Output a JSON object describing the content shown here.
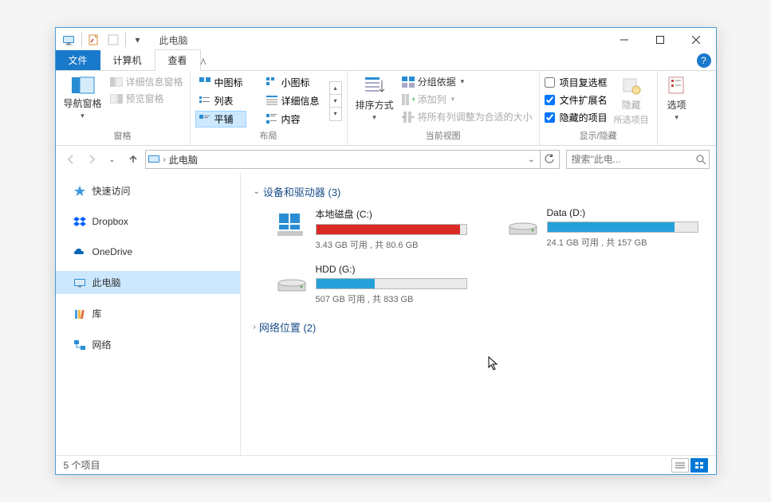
{
  "titlebar": {
    "title": "此电脑"
  },
  "tabs": {
    "file": "文件",
    "computer": "计算机",
    "view": "查看"
  },
  "ribbon": {
    "panes": {
      "label": "窗格",
      "nav_pane": "导航窗格",
      "preview_pane": "预览窗格",
      "details_pane": "详细信息窗格"
    },
    "layout": {
      "label": "布局",
      "medium_icons": "中图标",
      "small_icons": "小图标",
      "list": "列表",
      "details": "详细信息",
      "tiles": "平铺",
      "content": "内容"
    },
    "current_view": {
      "label": "当前视图",
      "sort_by": "排序方式",
      "group_by": "分组依据",
      "add_columns": "添加列",
      "size_columns": "将所有列调整为合适的大小"
    },
    "show_hide": {
      "label": "显示/隐藏",
      "item_checkboxes": "项目复选框",
      "file_exts": "文件扩展名",
      "hidden_items": "隐藏的项目",
      "hide": "隐藏",
      "hide_sub": "所选项目"
    },
    "options": {
      "label": "选项"
    }
  },
  "addr": {
    "location": "此电脑"
  },
  "search": {
    "placeholder": "搜索\"此电..."
  },
  "sidebar": {
    "items": [
      {
        "label": "快速访问"
      },
      {
        "label": "Dropbox"
      },
      {
        "label": "OneDrive"
      },
      {
        "label": "此电脑"
      },
      {
        "label": "库"
      },
      {
        "label": "网络"
      }
    ]
  },
  "content": {
    "section1": {
      "title": "设备和驱动器 (3)"
    },
    "section2": {
      "title": "网络位置 (2)"
    },
    "drives": [
      {
        "name": "本地磁盘 (C:)",
        "stats": "3.43 GB 可用 , 共 80.6 GB",
        "fill_pct": 96,
        "color": "#da2a26",
        "type": "os"
      },
      {
        "name": "Data (D:)",
        "stats": "24.1 GB 可用 , 共 157 GB",
        "fill_pct": 85,
        "color": "#26a0da",
        "type": "hdd"
      },
      {
        "name": "HDD (G:)",
        "stats": "507 GB 可用 , 共 833 GB",
        "fill_pct": 39,
        "color": "#26a0da",
        "type": "hdd"
      }
    ]
  },
  "status": {
    "text": "5 个项目"
  }
}
